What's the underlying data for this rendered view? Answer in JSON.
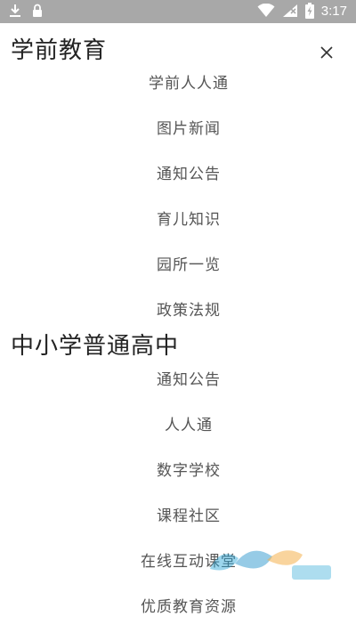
{
  "status_bar": {
    "time": "3:17",
    "icons": [
      "download-icon",
      "lock-icon",
      "wifi-icon",
      "signal-icon",
      "battery-charging-icon"
    ]
  },
  "sections": [
    {
      "title": "学前教育",
      "items": [
        "学前人人通",
        "图片新闻",
        "通知公告",
        "育儿知识",
        "园所一览",
        "政策法规"
      ]
    },
    {
      "title": "中小学普通高中",
      "items": [
        "通知公告",
        "人人通",
        "数字学校",
        "课程社区",
        "在线互动课堂",
        "优质教育资源"
      ]
    }
  ],
  "colors": {
    "status_bar": "#a8a8a8",
    "title": "#222222",
    "item": "#555555"
  }
}
